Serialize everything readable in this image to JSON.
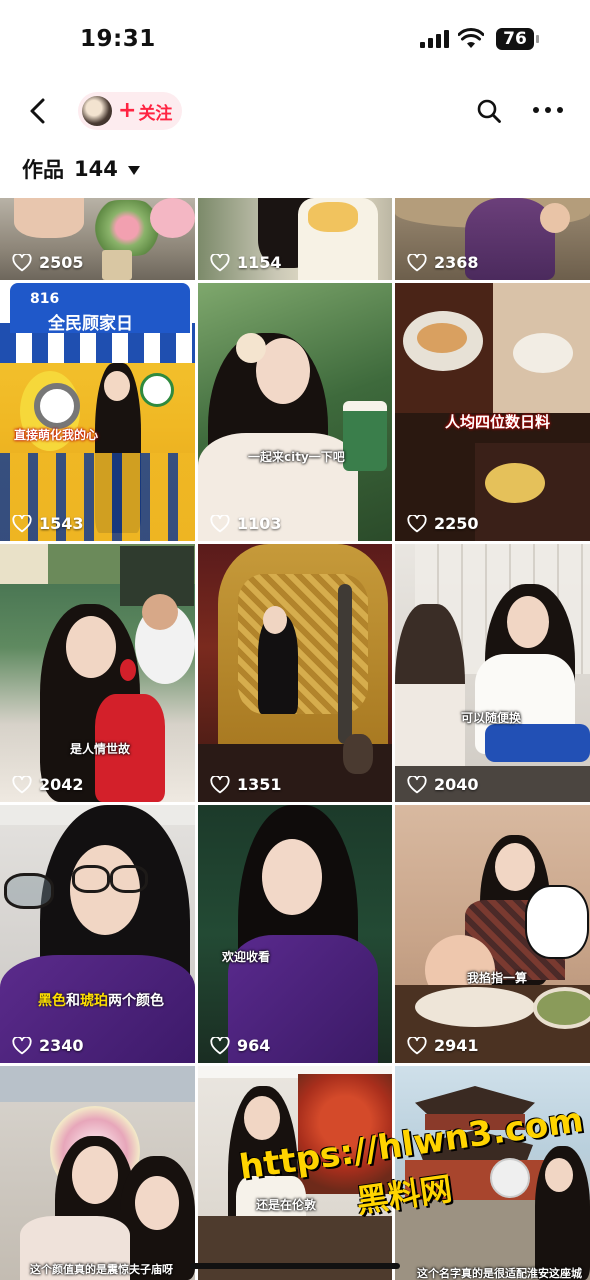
{
  "status_bar": {
    "time": "19:31",
    "battery": "76"
  },
  "nav": {
    "follow_label": "关注",
    "follow_plus": "+"
  },
  "works": {
    "label": "作品",
    "count": "144"
  },
  "colors": {
    "accent": "#ff2442",
    "follow_bg": "#fdecef"
  },
  "tiles": [
    {
      "likes": "2505",
      "caption": ""
    },
    {
      "likes": "1154",
      "caption": ""
    },
    {
      "likes": "2368",
      "caption": ""
    },
    {
      "likes": "1543",
      "caption": "直接萌化我的心",
      "sign_top": "816",
      "sign_main": "全民顾家日"
    },
    {
      "likes": "1103",
      "caption": "一起来city一下吧"
    },
    {
      "likes": "2250",
      "caption": "人均四位数日料"
    },
    {
      "likes": "2042",
      "caption": "是人情世故"
    },
    {
      "likes": "1351",
      "caption": ""
    },
    {
      "likes": "2040",
      "caption": "可以随便换"
    },
    {
      "likes": "2340",
      "caption_a": "黑色",
      "caption_b": "和",
      "caption_c": "琥珀",
      "caption_d": "两个颜色"
    },
    {
      "likes": "964",
      "caption": "欢迎收看"
    },
    {
      "likes": "2941",
      "caption": "我掐指一算"
    },
    {
      "likes": "",
      "caption": "这个颜值真的是震惊夫子庙呀"
    },
    {
      "likes": "",
      "caption": "还是在伦敦"
    },
    {
      "likes": "",
      "caption": "这个名字真的是很适配淮安这座城"
    }
  ],
  "watermark": {
    "line1": "https://hlwn3.com",
    "line2": "黑料网"
  }
}
